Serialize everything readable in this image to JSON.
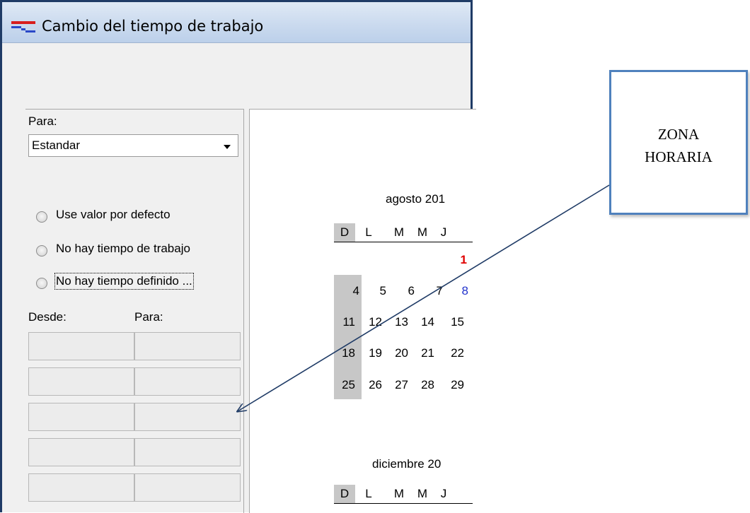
{
  "window": {
    "title": "Cambio del tiempo de trabajo",
    "icon": "project-calendar-icon"
  },
  "left": {
    "for_label": "Para:",
    "calendar_select": {
      "value": "Estandar"
    },
    "radios": [
      {
        "label": "Use valor por defecto"
      },
      {
        "label": "No hay tiempo de trabajo"
      },
      {
        "label": "No hay tiempo definido ..."
      }
    ],
    "from_label": "Desde:",
    "to_label": "Para:"
  },
  "calendar": {
    "months": [
      {
        "title": "agosto 201",
        "weekdays": [
          "D",
          "L",
          "M",
          "M",
          "J"
        ],
        "rows": [
          [
            "",
            "",
            "",
            "",
            "1"
          ],
          [
            "4",
            "5",
            "6",
            "7",
            "8"
          ],
          [
            "11",
            "12",
            "13",
            "14",
            "15"
          ],
          [
            "18",
            "19",
            "20",
            "21",
            "22"
          ],
          [
            "25",
            "26",
            "27",
            "28",
            "29"
          ]
        ]
      },
      {
        "title": "diciembre 20",
        "weekdays": [
          "D",
          "L",
          "M",
          "M",
          "J"
        ]
      }
    ]
  },
  "callout": {
    "text": "ZONA\nHORARIA",
    "border_color": "#4f81bd",
    "arrow_color": "#1f3b66"
  }
}
